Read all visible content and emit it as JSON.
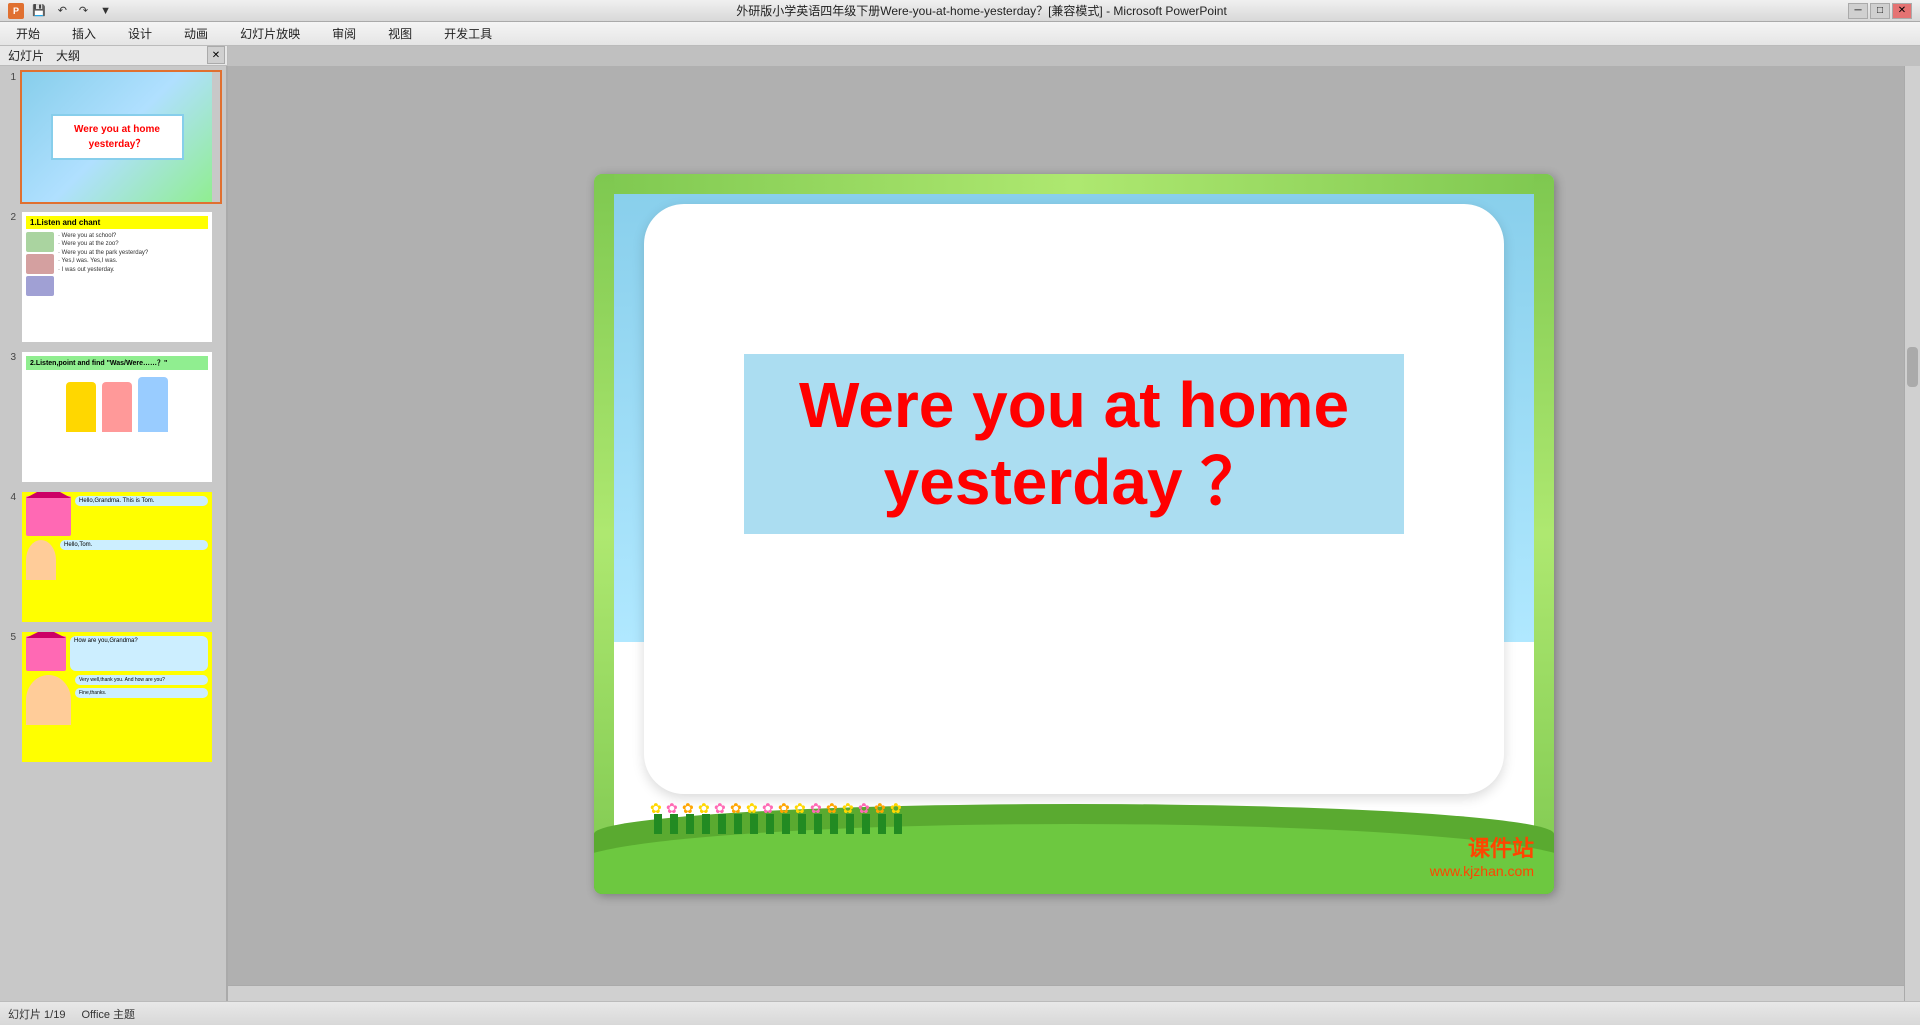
{
  "titlebar": {
    "title": "外研版小学英语四年级下册Were-you-at-home-yesterday？[兼容模式] - Microsoft PowerPoint",
    "minimize_label": "─",
    "maximize_label": "□",
    "close_label": "✕",
    "app_icon_label": "P"
  },
  "ribbon": {
    "tabs": [
      "开始",
      "插入",
      "设计",
      "动画",
      "幻灯片放映",
      "审阅",
      "视图",
      "开发工具"
    ]
  },
  "panel": {
    "close_label": "✕",
    "tab1": "幻灯片",
    "tab2": "大纲"
  },
  "slides": [
    {
      "number": "1",
      "title": "Were you at home yesterday？"
    },
    {
      "number": "2",
      "title": "1.Listen and chant",
      "bullets": [
        "Were you at school?",
        "Were you at the zoo?",
        "Were you at the park yesterday?",
        "Yes,I was. Yes,I was.",
        "I was out yesterday."
      ]
    },
    {
      "number": "3",
      "title": "2.Listen,point and find \"Was/Were……？\""
    },
    {
      "number": "4",
      "dialog1": "Hello,Grandma. This is Tom.",
      "dialog2": "Hello,Tom."
    },
    {
      "number": "5",
      "dialog1": "How are you,Grandma?",
      "dialog2": "Very well,thank you. And how are you?",
      "dialog3": "Fine,thanks."
    }
  ],
  "main_slide": {
    "heading_line1": "Were you at home",
    "heading_line2": "yesterday ？",
    "heading": "Were you at home yesterday ？"
  },
  "watermark": {
    "line1": "课件站",
    "line2": "www.kjzhan.com"
  },
  "status": {
    "slide_info": "幻灯片 1/19",
    "theme": "Office 主题"
  }
}
